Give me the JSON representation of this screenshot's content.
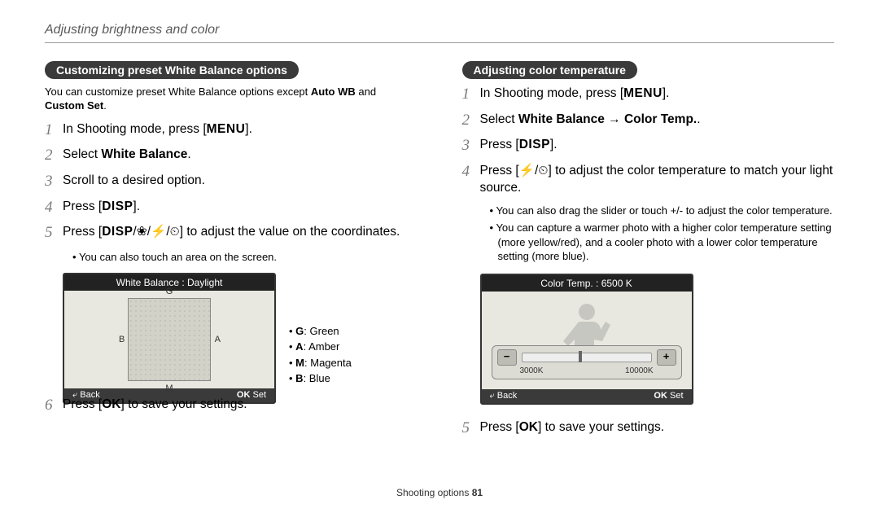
{
  "header": "Adjusting brightness and color",
  "left": {
    "pill": "Customizing preset White Balance options",
    "intro_a": "You can customize preset White Balance options except ",
    "intro_b": "Auto WB",
    "intro_c": " and ",
    "intro_d": "Custom Set",
    "s1_a": "In Shooting mode, press [",
    "s1_b": "MENU",
    "s1_c": "].",
    "s2_a": "Select ",
    "s2_b": "White Balance",
    "s2_c": ".",
    "s3": "Scroll to a desired option.",
    "s4_a": "Press [",
    "s4_b": "DISP",
    "s4_c": "].",
    "s5_a": "Press [",
    "s5_b": "DISP",
    "s5_c": "/",
    "s5_d": "/",
    "s5_e": "] to adjust the value on the coordinates.",
    "s5_sub": "You can also touch an area on the screen.",
    "shot_title": "White Balance : Daylight",
    "axis_g": "G",
    "axis_m": "M",
    "axis_b": "B",
    "axis_a": "A",
    "back": "Back",
    "ok": "OK",
    "set": "Set",
    "leg_g": "G",
    "leg_g2": ": Green",
    "leg_a": "A",
    "leg_a2": ": Amber",
    "leg_m": "M",
    "leg_m2": ": Magenta",
    "leg_b": "B",
    "leg_b2": ": Blue",
    "s6_a": "Press [",
    "s6_b": "OK",
    "s6_c": "] to save your settings."
  },
  "right": {
    "pill": "Adjusting color temperature",
    "s1_a": "In Shooting mode, press [",
    "s1_b": "MENU",
    "s1_c": "].",
    "s2_a": "Select ",
    "s2_b": "White Balance",
    "s2_arrow": " → ",
    "s2_c": "Color Temp.",
    "s2_d": ".",
    "s3_a": "Press [",
    "s3_b": "DISP",
    "s3_c": "].",
    "s4_a": "Press [",
    "s4_b": "/",
    "s4_c": "] to adjust the color temperature to match your light source.",
    "sub1": "You can also drag the slider or touch +/- to adjust the color temperature.",
    "sub2": "You can capture a warmer photo with a higher color temperature setting (more yellow/red), and a cooler photo with a lower color temperature setting (more blue).",
    "shot_title": "Color Temp. : 6500 K",
    "minus": "−",
    "plus": "+",
    "lo": "3000K",
    "hi": "10000K",
    "back": "Back",
    "ok": "OK",
    "set": "Set",
    "s5_a": "Press [",
    "s5_b": "OK",
    "s5_c": "] to save your settings."
  },
  "footer_a": "Shooting options  ",
  "footer_b": "81"
}
